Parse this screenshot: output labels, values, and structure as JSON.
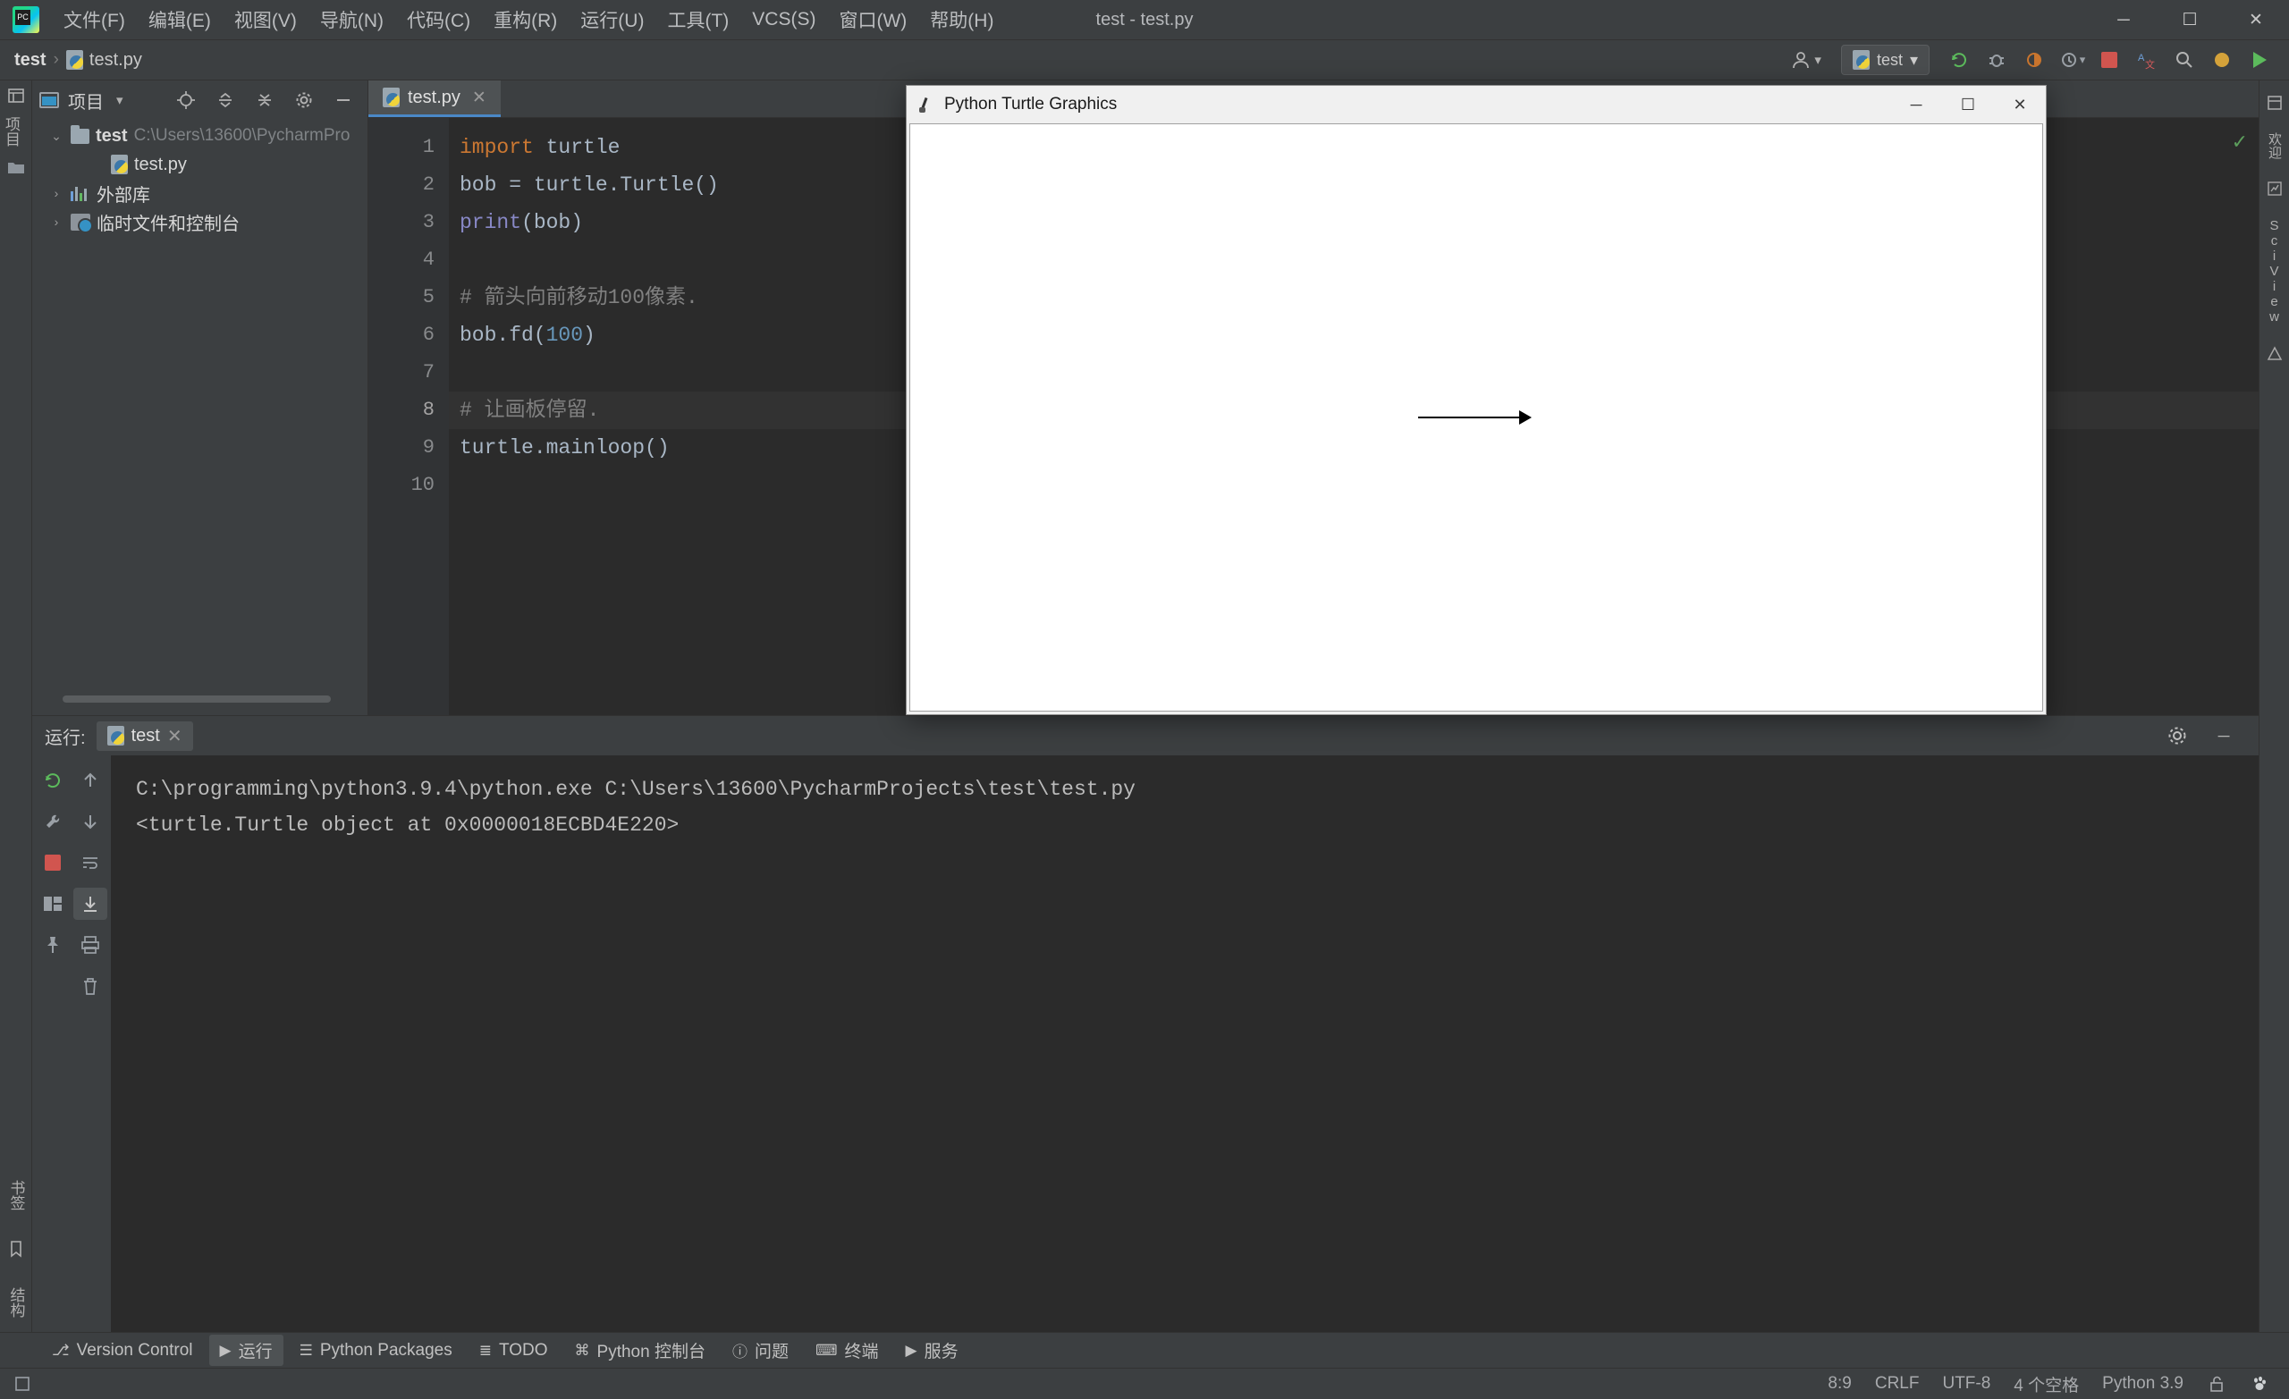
{
  "window": {
    "title": "test - test.py",
    "minimize": "─",
    "maximize": "☐",
    "close": "✕"
  },
  "menu": {
    "items": [
      {
        "label": "文件(F)"
      },
      {
        "label": "编辑(E)"
      },
      {
        "label": "视图(V)"
      },
      {
        "label": "导航(N)"
      },
      {
        "label": "代码(C)"
      },
      {
        "label": "重构(R)"
      },
      {
        "label": "运行(U)"
      },
      {
        "label": "工具(T)"
      },
      {
        "label": "VCS(S)"
      },
      {
        "label": "窗口(W)"
      },
      {
        "label": "帮助(H)"
      }
    ]
  },
  "navbar": {
    "breadcrumb": {
      "root": "test",
      "separator": "›",
      "file": "test.py"
    },
    "run_config": {
      "label": "test",
      "chevron": "▾"
    },
    "account_icon": "account-icon",
    "buttons": [
      {
        "name": "rerun-icon",
        "glyph": "↺"
      },
      {
        "name": "debug-icon",
        "glyph": "⚙"
      },
      {
        "name": "coverage-icon",
        "glyph": "⬤"
      },
      {
        "name": "profile-icon",
        "glyph": "◔"
      },
      {
        "name": "stop-icon",
        "glyph": ""
      },
      {
        "name": "translate-icon",
        "glyph": "文"
      },
      {
        "name": "search-icon",
        "glyph": "⌕"
      }
    ]
  },
  "left_strip": {
    "project_label": "项目",
    "bookmark_label": "书签",
    "structure_label": "结构"
  },
  "project_panel": {
    "title": "项目",
    "chevron": "▾",
    "tree": [
      {
        "indent": 0,
        "arrow": "⌄",
        "icon": "folder-icon",
        "name": "test",
        "bold": true,
        "path": "C:\\Users\\13600\\PycharmPro"
      },
      {
        "indent": 1,
        "arrow": "",
        "icon": "python-file-icon",
        "name": "test.py",
        "bold": false,
        "path": ""
      },
      {
        "indent": 0,
        "arrow": "›",
        "icon": "external-libraries-icon",
        "name": "外部库",
        "bold": false,
        "path": ""
      },
      {
        "indent": 0,
        "arrow": "›",
        "icon": "scratches-icon",
        "name": "临时文件和控制台",
        "bold": false,
        "path": ""
      }
    ]
  },
  "editor": {
    "tab": {
      "label": "test.py",
      "close": "✕"
    },
    "lines": [
      {
        "no": "1",
        "tokens": [
          {
            "t": "kw",
            "v": "import"
          },
          {
            "t": "txt",
            "v": " turtle"
          }
        ]
      },
      {
        "no": "2",
        "tokens": [
          {
            "t": "txt",
            "v": "bob = turtle.Turtle()"
          }
        ]
      },
      {
        "no": "3",
        "tokens": [
          {
            "t": "fn",
            "v": "print"
          },
          {
            "t": "txt",
            "v": "(bob)"
          }
        ]
      },
      {
        "no": "4",
        "tokens": [
          {
            "t": "txt",
            "v": ""
          }
        ]
      },
      {
        "no": "5",
        "tokens": [
          {
            "t": "cm",
            "v": "# 箭头向前移动100像素."
          }
        ]
      },
      {
        "no": "6",
        "tokens": [
          {
            "t": "txt",
            "v": "bob.fd("
          },
          {
            "t": "num",
            "v": "100"
          },
          {
            "t": "txt",
            "v": ")"
          }
        ]
      },
      {
        "no": "7",
        "tokens": [
          {
            "t": "txt",
            "v": ""
          }
        ]
      },
      {
        "no": "8",
        "tokens": [
          {
            "t": "cm",
            "v": "# 让画板停留."
          }
        ],
        "highlight": true
      },
      {
        "no": "9",
        "tokens": [
          {
            "t": "txt",
            "v": "turtle.mainloop()"
          }
        ]
      },
      {
        "no": "10",
        "tokens": [
          {
            "t": "txt",
            "v": ""
          }
        ]
      }
    ],
    "inspection_ok": "✓"
  },
  "run_window": {
    "label": "运行:",
    "tab": {
      "label": "test",
      "close": "✕"
    },
    "console_lines": [
      "C:\\programming\\python3.9.4\\python.exe C:\\Users\\13600\\PycharmProjects\\test\\test.py",
      "<turtle.Turtle object at 0x0000018ECBD4E220>"
    ],
    "settings_icon": "gear-icon",
    "hide_icon": "─",
    "side_buttons": [
      {
        "name": "rerun-icon",
        "glyph": "↺"
      },
      {
        "name": "scroll-up-icon",
        "glyph": "↑"
      },
      {
        "name": "wrench-icon",
        "glyph": "⚒"
      },
      {
        "name": "scroll-down-icon",
        "glyph": "↓"
      },
      {
        "name": "stop-icon",
        "glyph": ""
      },
      {
        "name": "soft-wrap-icon",
        "glyph": "↵"
      },
      {
        "name": "layout-icon",
        "glyph": "▤"
      },
      {
        "name": "scroll-to-end-icon",
        "glyph": "⤓"
      },
      {
        "name": "pin-icon",
        "glyph": "📌"
      },
      {
        "name": "print-icon",
        "glyph": "⎙"
      },
      {
        "name": "trash-icon",
        "glyph": "🗑"
      }
    ]
  },
  "turtle_window": {
    "title": "Python Turtle Graphics",
    "minimize": "─",
    "maximize": "☐",
    "close": "✕",
    "drawing": {
      "type": "arrow",
      "length": 100,
      "description": "forward 100 pixels"
    }
  },
  "bottom_tabs": [
    {
      "name": "version-control",
      "icon": "⎇",
      "label": "Version Control",
      "active": false
    },
    {
      "name": "run",
      "icon": "▶",
      "label": "运行",
      "active": true
    },
    {
      "name": "python-packages",
      "icon": "☰",
      "label": "Python Packages",
      "active": false
    },
    {
      "name": "todo",
      "icon": "≣",
      "label": "TODO",
      "active": false
    },
    {
      "name": "python-console",
      "icon": "⌘",
      "label": "Python 控制台",
      "active": false
    },
    {
      "name": "problems",
      "icon": "ⓘ",
      "label": "问题",
      "active": false
    },
    {
      "name": "terminal",
      "icon": "⌨",
      "label": "终端",
      "active": false
    },
    {
      "name": "services",
      "icon": "▶",
      "label": "服务",
      "active": false
    }
  ],
  "statusbar": {
    "caret": "8:9",
    "line_separator": "CRLF",
    "encoding": "UTF-8",
    "indent": "4 个空格",
    "interpreter": "Python 3.9",
    "lock_icon": "🔓",
    "extra_icon": "paw-icon"
  },
  "colors": {
    "accent_blue": "#4a88c7",
    "bg_panel": "#3c3f41",
    "bg_editor": "#2b2b2b",
    "keyword_orange": "#cc7832",
    "number_blue": "#6897bb",
    "function_purple": "#8888c6"
  }
}
